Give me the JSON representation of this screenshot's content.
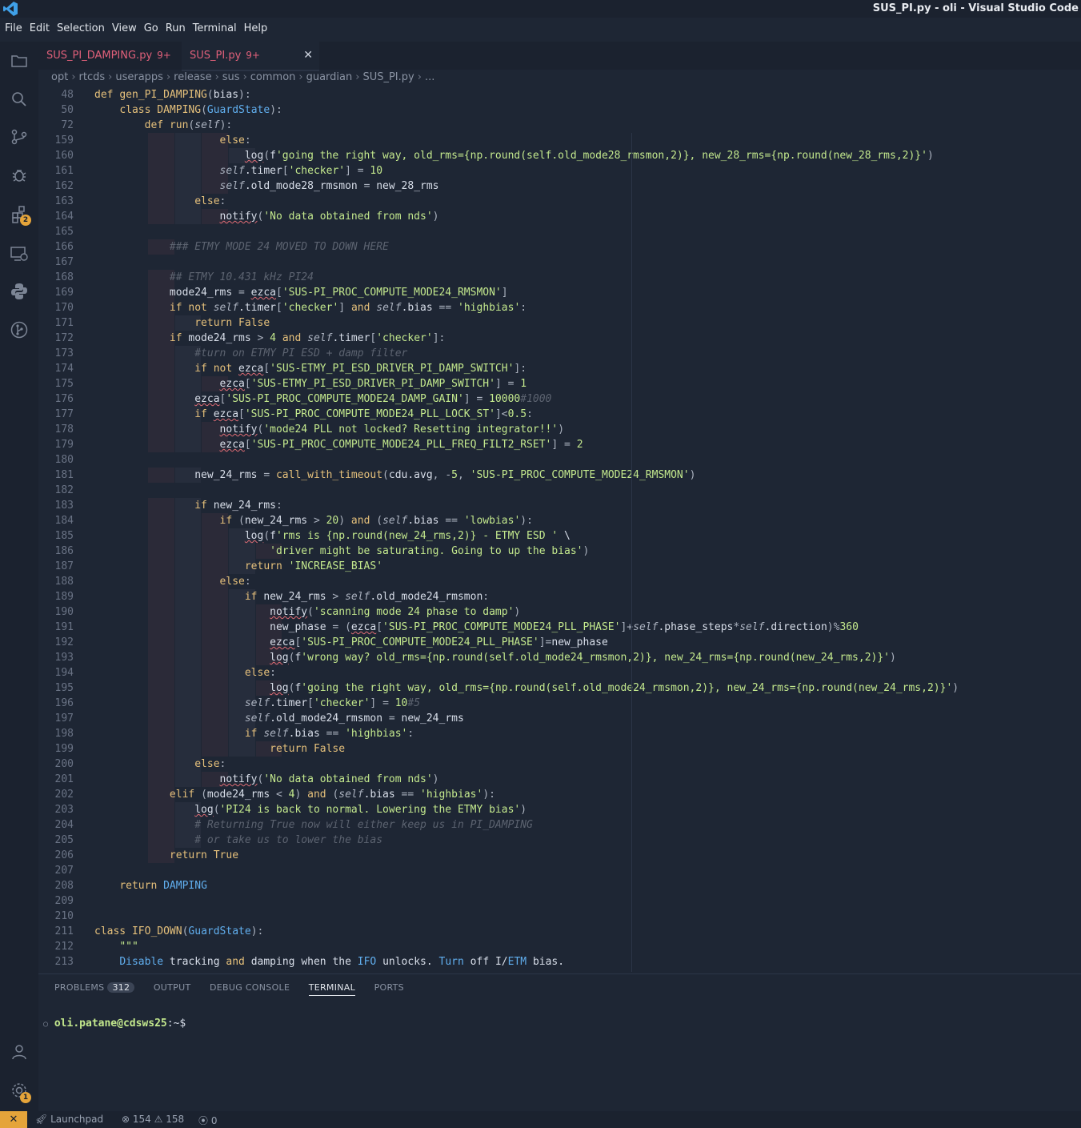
{
  "window": {
    "title": "SUS_PI.py - oli - Visual Studio Code"
  },
  "menu": [
    "File",
    "Edit",
    "Selection",
    "View",
    "Go",
    "Run",
    "Terminal",
    "Help"
  ],
  "activity": {
    "extensions_badge": "2",
    "accounts_badge": "1"
  },
  "tabs": [
    {
      "name": "SUS_PI_DAMPING.py",
      "mod": "9+"
    },
    {
      "name": "SUS_PI.py",
      "mod": "9+"
    }
  ],
  "breadcrumb": [
    "opt",
    "rtcds",
    "userapps",
    "release",
    "sus",
    "common",
    "guardian",
    "SUS_PI.py",
    "..."
  ],
  "editor": {
    "lines": [
      {
        "n": "48",
        "t": "def gen_PI_DAMPING(bias):"
      },
      {
        "n": "50",
        "t": "    class DAMPING(GuardState):"
      },
      {
        "n": "72",
        "t": "        def run(self):"
      },
      {
        "n": "159",
        "t": "                    else:"
      },
      {
        "n": "160",
        "t": "                        log(f'going the right way, old_rms={np.round(self.old_mode28_rmsmon,2)}, new_28_rms={np.round(new_28_rms,2)}')"
      },
      {
        "n": "161",
        "t": "                    self.timer['checker'] = 10"
      },
      {
        "n": "162",
        "t": "                    self.old_mode28_rmsmon = new_28_rms"
      },
      {
        "n": "163",
        "t": "                else:"
      },
      {
        "n": "164",
        "t": "                    notify('No data obtained from nds')"
      },
      {
        "n": "165",
        "t": ""
      },
      {
        "n": "166",
        "t": "            ### ETMY MODE 24 MOVED TO DOWN HERE"
      },
      {
        "n": "167",
        "t": ""
      },
      {
        "n": "168",
        "t": "            ## ETMY 10.431 kHz PI24"
      },
      {
        "n": "169",
        "t": "            mode24_rms = ezca['SUS-PI_PROC_COMPUTE_MODE24_RMSMON']"
      },
      {
        "n": "170",
        "t": "            if not self.timer['checker'] and self.bias == 'highbias':"
      },
      {
        "n": "171",
        "t": "                return False"
      },
      {
        "n": "172",
        "t": "            if mode24_rms > 4 and self.timer['checker']:"
      },
      {
        "n": "173",
        "t": "                #turn on ETMY PI ESD + damp filter"
      },
      {
        "n": "174",
        "t": "                if not ezca['SUS-ETMY_PI_ESD_DRIVER_PI_DAMP_SWITCH']:"
      },
      {
        "n": "175",
        "t": "                    ezca['SUS-ETMY_PI_ESD_DRIVER_PI_DAMP_SWITCH'] = 1"
      },
      {
        "n": "176",
        "t": "                ezca['SUS-PI_PROC_COMPUTE_MODE24_DAMP_GAIN'] = 10000#1000"
      },
      {
        "n": "177",
        "t": "                if ezca['SUS-PI_PROC_COMPUTE_MODE24_PLL_LOCK_ST']<0.5:"
      },
      {
        "n": "178",
        "t": "                    notify('mode24 PLL not locked? Resetting integrator!!')"
      },
      {
        "n": "179",
        "t": "                    ezca['SUS-PI_PROC_COMPUTE_MODE24_PLL_FREQ_FILT2_RSET'] = 2"
      },
      {
        "n": "180",
        "t": ""
      },
      {
        "n": "181",
        "t": "                new_24_rms = call_with_timeout(cdu.avg, -5, 'SUS-PI_PROC_COMPUTE_MODE24_RMSMON')"
      },
      {
        "n": "182",
        "t": ""
      },
      {
        "n": "183",
        "t": "                if new_24_rms:"
      },
      {
        "n": "184",
        "t": "                    if (new_24_rms > 20) and (self.bias == 'lowbias'):"
      },
      {
        "n": "185",
        "t": "                        log(f'rms is {np.round(new_24_rms,2)} - ETMY ESD ' \\"
      },
      {
        "n": "186",
        "t": "                            'driver might be saturating. Going to up the bias')"
      },
      {
        "n": "187",
        "t": "                        return 'INCREASE_BIAS'"
      },
      {
        "n": "188",
        "t": "                    else:"
      },
      {
        "n": "189",
        "t": "                        if new_24_rms > self.old_mode24_rmsmon:"
      },
      {
        "n": "190",
        "t": "                            notify('scanning mode 24 phase to damp')"
      },
      {
        "n": "191",
        "t": "                            new_phase = (ezca['SUS-PI_PROC_COMPUTE_MODE24_PLL_PHASE']+self.phase_steps*self.direction)%360"
      },
      {
        "n": "192",
        "t": "                            ezca['SUS-PI_PROC_COMPUTE_MODE24_PLL_PHASE']=new_phase"
      },
      {
        "n": "193",
        "t": "                            log(f'wrong way? old_rms={np.round(self.old_mode24_rmsmon,2)}, new_24_rms={np.round(new_24_rms,2)}')"
      },
      {
        "n": "194",
        "t": "                        else:"
      },
      {
        "n": "195",
        "t": "                            log(f'going the right way, old_rms={np.round(self.old_mode24_rmsmon,2)}, new_24_rms={np.round(new_24_rms,2)}')"
      },
      {
        "n": "196",
        "t": "                        self.timer['checker'] = 10#5"
      },
      {
        "n": "197",
        "t": "                        self.old_mode24_rmsmon = new_24_rms"
      },
      {
        "n": "198",
        "t": "                        if self.bias == 'highbias':"
      },
      {
        "n": "199",
        "t": "                            return False"
      },
      {
        "n": "200",
        "t": "                else:"
      },
      {
        "n": "201",
        "t": "                    notify('No data obtained from nds')"
      },
      {
        "n": "202",
        "t": "            elif (mode24_rms < 4) and (self.bias == 'highbias'):"
      },
      {
        "n": "203",
        "t": "                log('PI24 is back to normal. Lowering the ETMY bias')"
      },
      {
        "n": "204",
        "t": "                # Returning True now will either keep us in PI_DAMPING"
      },
      {
        "n": "205",
        "t": "                # or take us to lower the bias"
      },
      {
        "n": "206",
        "t": "            return True"
      },
      {
        "n": "207",
        "t": ""
      },
      {
        "n": "208",
        "t": "    return DAMPING"
      },
      {
        "n": "209",
        "t": ""
      },
      {
        "n": "210",
        "t": ""
      },
      {
        "n": "211",
        "t": "class IFO_DOWN(GuardState):"
      },
      {
        "n": "212",
        "t": "    \"\"\""
      },
      {
        "n": "213",
        "t": "    Disable tracking and damping when the IFO unlocks. Turn off I/ETM bias."
      }
    ]
  },
  "panel": {
    "tabs": [
      "PROBLEMS",
      "OUTPUT",
      "DEBUG CONSOLE",
      "TERMINAL",
      "PORTS"
    ],
    "problems_count": "312",
    "terminal_user": "oli.patane@cdsws25",
    "terminal_path": ":~$"
  },
  "status": {
    "launchpad": "Launchpad",
    "errors": "154",
    "warnings": "158",
    "ports": "0"
  },
  "colors": {
    "accent": "#e5a43a",
    "tab_modified": "#e0607a",
    "background": "#1e2634"
  }
}
